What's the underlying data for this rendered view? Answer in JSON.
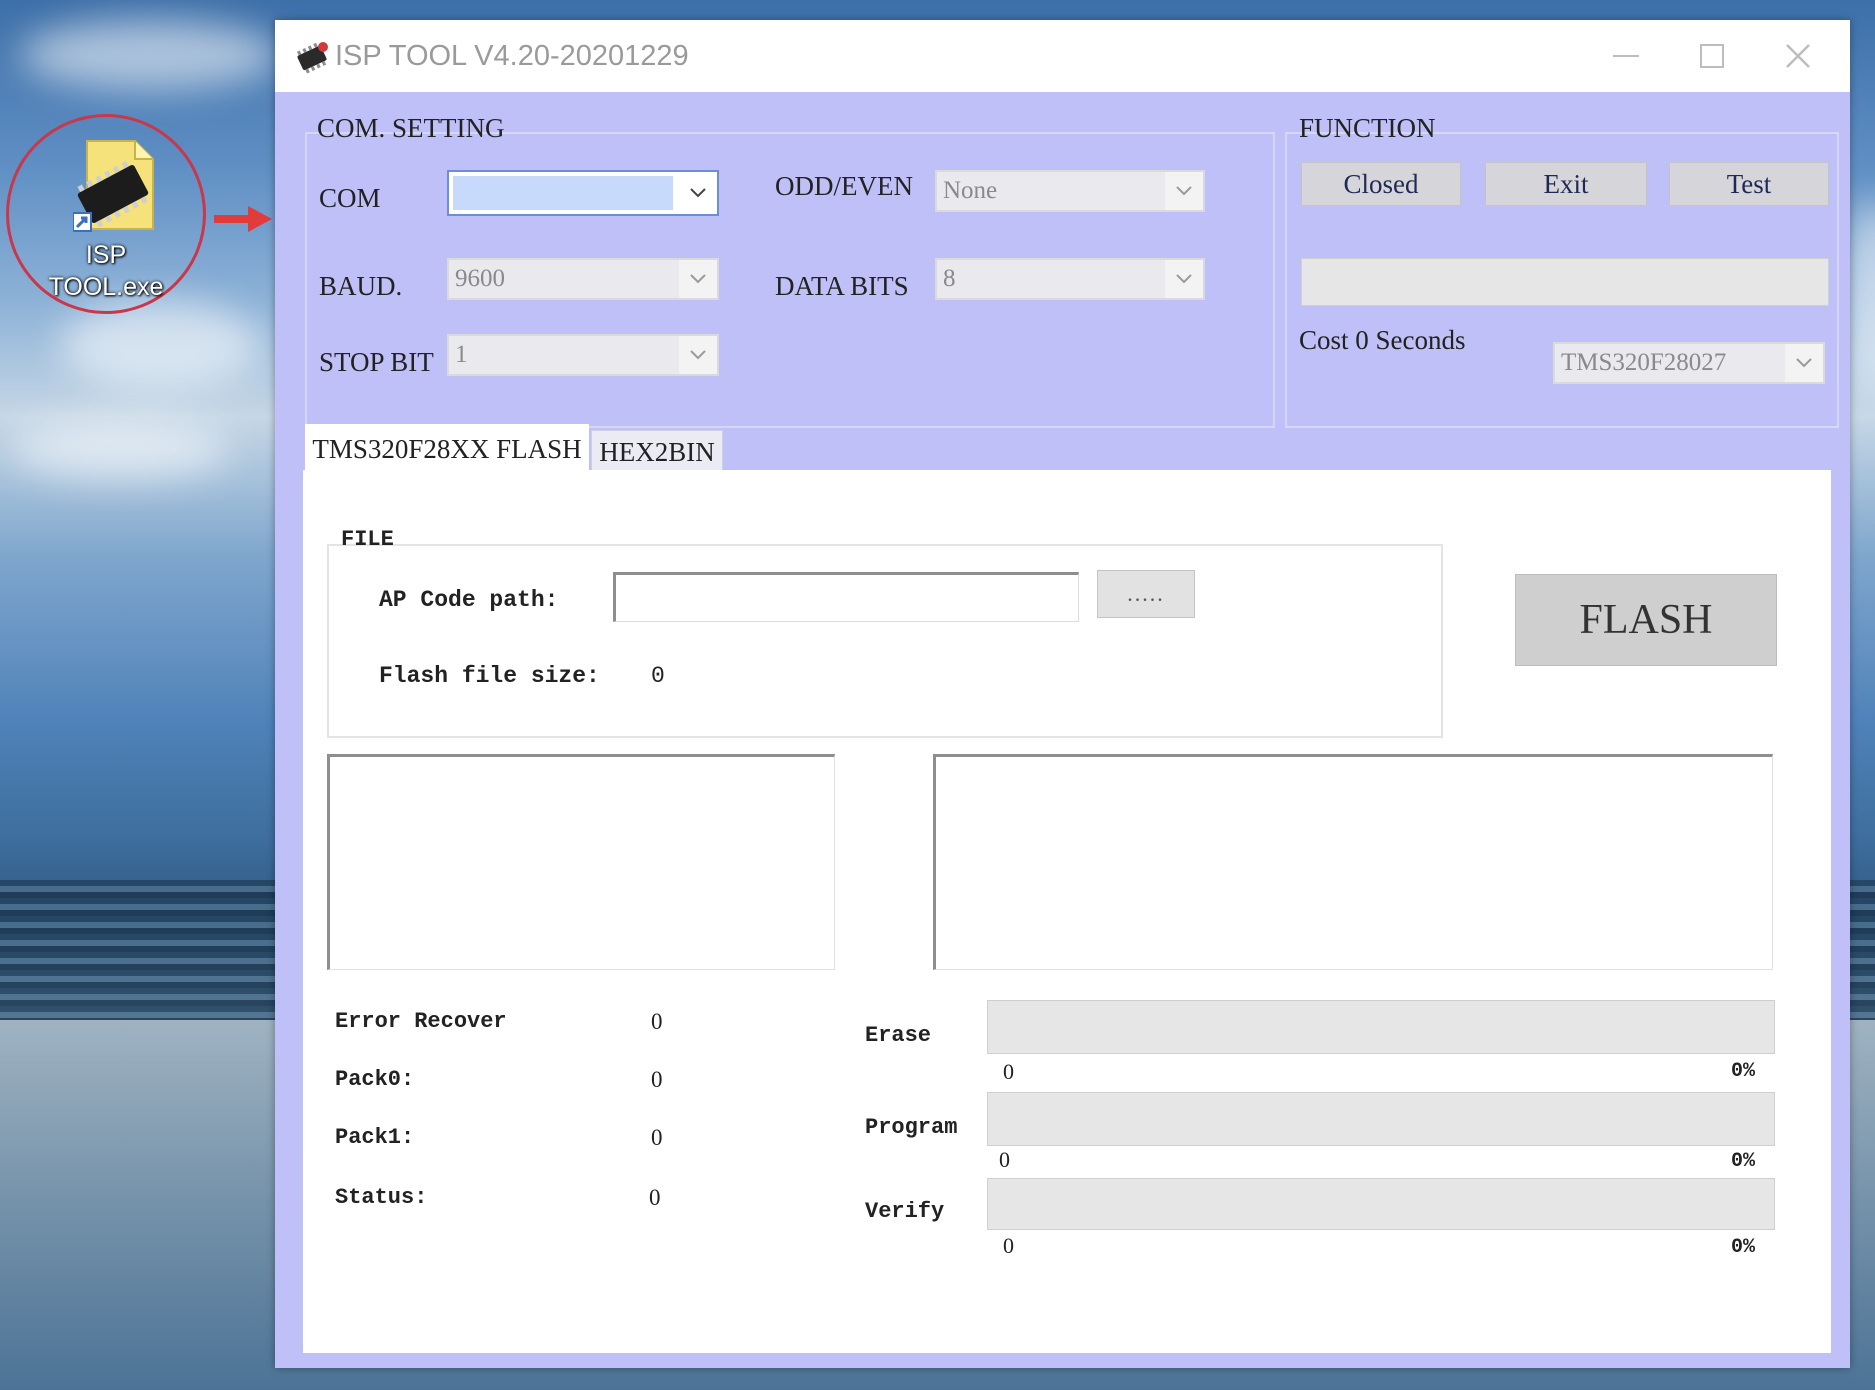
{
  "desktop": {
    "icon_label_line1": "ISP",
    "icon_label_line2": "TOOL.exe",
    "icon": "chip-file-icon"
  },
  "window": {
    "title": "ISP TOOL V4.20-20201229",
    "app_icon": "isp-tool-icon",
    "minimize_icon": "minimize-icon",
    "maximize_icon": "maximize-icon",
    "close_icon": "close-icon"
  },
  "com_setting": {
    "title": "COM. SETTING",
    "com_label": "COM",
    "com_value": "",
    "odd_even_label": "ODD/EVEN",
    "odd_even_value": "None",
    "baud_label": "BAUD.",
    "baud_value": "9600",
    "data_bits_label": "DATA BITS",
    "data_bits_value": "8",
    "stop_bit_label": "STOP BIT",
    "stop_bit_value": "1"
  },
  "function": {
    "title": "FUNCTION",
    "closed_label": "Closed",
    "exit_label": "Exit",
    "test_label": "Test",
    "cost_text": "Cost 0 Seconds",
    "chip_value": "TMS320F28027"
  },
  "tabs": [
    {
      "label": "TMS320F28XX FLASH",
      "active": true
    },
    {
      "label": "HEX2BIN",
      "active": false
    }
  ],
  "file": {
    "title": "FILE",
    "ap_code_path_label": "AP Code path:",
    "ap_code_path_value": "",
    "browse_label": ".....",
    "flash_file_size_label": "Flash file size:",
    "flash_file_size_value": "0"
  },
  "flash_button_label": "FLASH",
  "stats": {
    "error_recover_label": "Error Recover",
    "error_recover_value": "0",
    "pack0_label": "Pack0:",
    "pack0_value": "0",
    "pack1_label": "Pack1:",
    "pack1_value": "0",
    "status_label": "Status:",
    "status_value": "0"
  },
  "progress": {
    "erase_label": "Erase",
    "erase_count": "0",
    "erase_percent": "0%",
    "erase_fraction": 0,
    "program_label": "Program",
    "program_count": "0",
    "program_percent": "0%",
    "program_fraction": 0,
    "verify_label": "Verify",
    "verify_count": "0",
    "verify_percent": "0%",
    "verify_fraction": 0
  },
  "colors": {
    "window_bg": "#c0c0f8",
    "highlight": "#c8dafc",
    "annotation_red": "#c8374a"
  }
}
